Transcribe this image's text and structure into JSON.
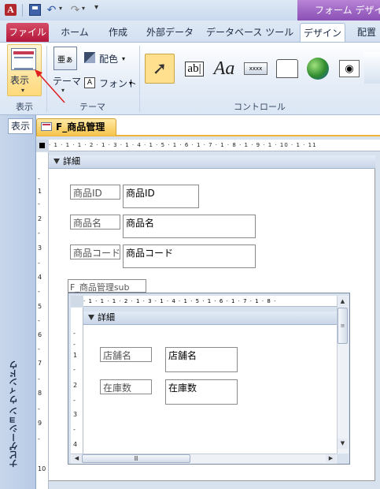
{
  "titlebar": {
    "app_icon": "A",
    "contextual_title": "フォーム デザイン",
    "qat_icons": [
      "access-icon",
      "save-icon",
      "undo-icon",
      "redo-icon",
      "customize-icon"
    ]
  },
  "ribbon_tabs": [
    "ファイル",
    "ホーム",
    "作成",
    "外部データ",
    "データベース ツール",
    "デザイン",
    "配置"
  ],
  "ribbon": {
    "view_group": {
      "button_label": "表示",
      "group_label": "表示"
    },
    "theme_group": {
      "theme_label": "テーマ",
      "color_label": "配色",
      "font_label": "フォント",
      "group_label": "テーマ",
      "theme_icon_text": "亜ぁ"
    },
    "controls_group": {
      "group_label": "コントロール",
      "textbox_text": "ab|",
      "label_text": "Aa",
      "button_text": "xxxx"
    }
  },
  "nav_pane": {
    "show_label": "表示",
    "vertical_label": "ナビゲーション ウィンドウ"
  },
  "document": {
    "tab_title": "F_商品管理",
    "ruler_text": "· 1 · 1 · 1 · 2 · 1 · 3 · 1 · 4 · 1 · 5 · 1 · 6 · 1 · 7 · 1 · 8 · 1 · 9 · 1 · 10 · 1 · 11",
    "vruler_marks": [
      "-",
      "1",
      "-",
      "2",
      "-",
      "3",
      "-",
      "4",
      "-",
      "5",
      "-",
      "6",
      "-",
      "7",
      "-",
      "8",
      "-",
      "9",
      "-",
      "10"
    ],
    "section_label": "詳細",
    "fields": [
      {
        "label": "商品ID",
        "control": "商品ID"
      },
      {
        "label": "商品名",
        "control": "商品名"
      },
      {
        "label": "商品コード",
        "control": "商品コード"
      }
    ],
    "subform": {
      "caption": "F_商品管理sub",
      "ruler_text": "· 1 · 1 · 1 · 2 · 1 · 3 · 1 · 4 · 1 · 5 · 1 · 6 · 1 · 7 · 1 · 8 · ",
      "vruler_marks": [
        "-",
        "-",
        "1",
        "-",
        "2",
        "-",
        "3",
        "-",
        "4"
      ],
      "section_label": "詳細",
      "fields": [
        {
          "label": "店舗名",
          "control": "店舗名"
        },
        {
          "label": "在庫数",
          "control": "在庫数"
        }
      ]
    }
  },
  "colors": {
    "file_tab": "#b4163a",
    "contextual_tab": "#8a4fb5",
    "doc_tab": "#f6c44c",
    "arrow": "#e02020"
  }
}
